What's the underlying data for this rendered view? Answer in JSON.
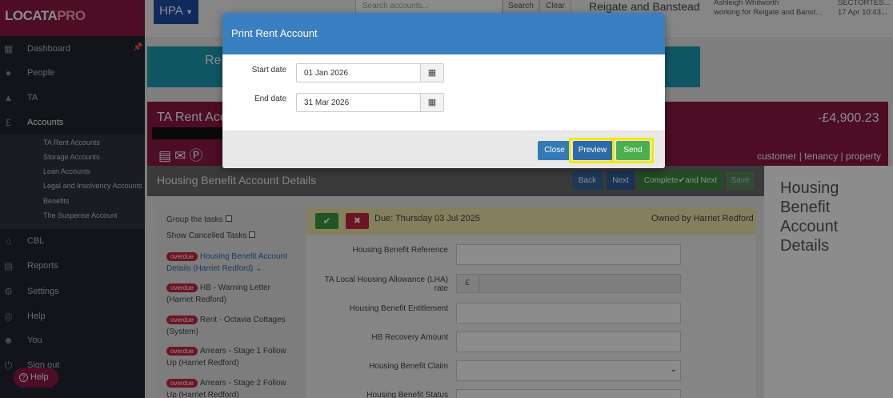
{
  "sidebar": {
    "logo_main": "LOCATA",
    "logo_accent": "PRO",
    "items": [
      {
        "label": "Dashboard",
        "icon": "grid-icon"
      },
      {
        "label": "People",
        "icon": "people-icon"
      },
      {
        "label": "TA",
        "icon": "road-icon"
      },
      {
        "label": "Accounts",
        "icon": "pound-icon"
      },
      {
        "label": "CBL",
        "icon": "home-icon"
      },
      {
        "label": "Reports",
        "icon": "document-icon"
      },
      {
        "label": "Settings",
        "icon": "gear-icon"
      },
      {
        "label": "Help",
        "icon": "lifebuoy-icon"
      },
      {
        "label": "You",
        "icon": "user-icon"
      },
      {
        "label": "Sign out",
        "icon": "power-icon"
      }
    ],
    "sub_items": [
      "TA Rent Accounts",
      "Storage Accounts",
      "Loan Accounts",
      "Legal and Insolvency Accounts",
      "Benefits",
      "The Suspense Account"
    ],
    "help_label": "Help"
  },
  "topbar": {
    "hpa_label": "HPA",
    "search_placeholder": "Search accounts...",
    "search_button": "Search",
    "clear_button": "Clear",
    "council": "Reigate and Banstead",
    "user_name": "Ashleigh Whitworth",
    "user_role": "working for Reigate and Banst...",
    "sector": "SECTORTES...",
    "datetime": "17 Apr 10:43..."
  },
  "banner": {
    "teal_title": "Re"
  },
  "account": {
    "title": "TA Rent Acc",
    "amount": "-£4,900.23",
    "link_customer": "customer",
    "link_tenancy": "tenancy",
    "link_property": "property",
    "sep": "|"
  },
  "panel": {
    "title": "Housing Benefit Account Details",
    "back": "Back",
    "next": "Next",
    "complete_pre": "Complete",
    "complete_post": "and Next",
    "save": "Save",
    "right_title": "Housing Benefit Account Details"
  },
  "tasks": {
    "group": "Group the tasks",
    "cancelled": "Show Cancelled Tasks",
    "badge": "overdue",
    "list": [
      "Housing Benefit Account Details (Harriet Redford)",
      "HB - Warning Letter (Harriet Redford)",
      "Rent - Octavia Cottages (System)",
      "Arrears - Stage 1 Follow Up (Harriet Redford)",
      "Arrears - Stage 2 Follow Up (Harriet Redford)"
    ]
  },
  "task_form": {
    "due": "Due: Thursday 03 Jul 2025",
    "owner": "Owned by Harriet Redford",
    "currency": "£",
    "fields": [
      "Housing Benefit Reference",
      "TA Local Housing Allowance (LHA) rate",
      "Housing Benefit Entitlement",
      "HB Recovery Amount",
      "Housing Benefit Claim",
      "Housing Benefit Status"
    ]
  },
  "modal": {
    "title": "Print Rent Account",
    "start_label": "Start date",
    "start_value": "01 Jan 2026",
    "end_label": "End date",
    "end_value": "31 Mar 2026",
    "close": "Close",
    "preview": "Preview",
    "send": "Send"
  },
  "colors": {
    "brand": "#8a1844",
    "modal_header": "#3a7fc1",
    "highlight": "#f5e800",
    "send": "#4cae4c"
  }
}
